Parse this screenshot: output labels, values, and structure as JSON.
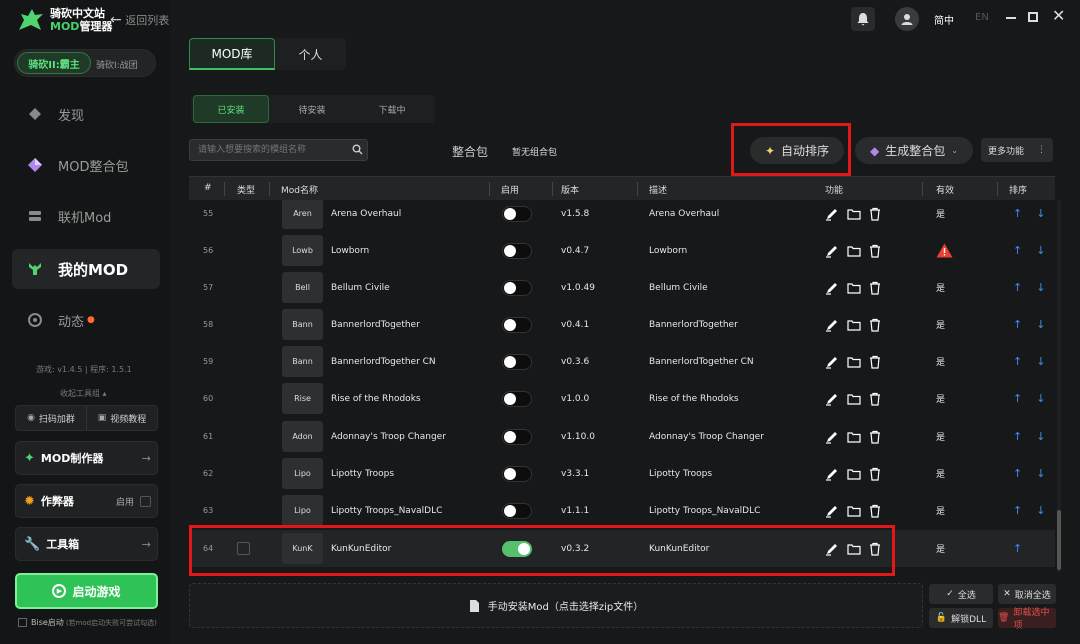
{
  "app": {
    "name_line1": "骑砍中文站",
    "name_line2_prefix": "MOD",
    "name_line2_suffix": "管理器",
    "back_label": "返回列表"
  },
  "game_switch": {
    "active": "骑砍II:霸主",
    "other": "骑砍I:战团"
  },
  "nav": [
    {
      "label": "发现",
      "icon": "discover-icon"
    },
    {
      "label": "MOD整合包",
      "icon": "diamond-icon"
    },
    {
      "label": "联机Mod",
      "icon": "network-icon"
    },
    {
      "label": "我的MOD",
      "icon": "my-mod-icon"
    },
    {
      "label": "动态",
      "icon": "chat-icon"
    }
  ],
  "version_info": {
    "game": "游戏: v1.4.5",
    "program": "程序: 1.5.1"
  },
  "collapse_tools": "收起工具组",
  "tools": {
    "scan": "扫码加群",
    "video": "视频教程"
  },
  "side_cards": {
    "mod_maker": "MOD制作器",
    "cheat": "作弊器",
    "cheat_toggle": "启用",
    "toolbox": "工具箱"
  },
  "launch_label": "启动游戏",
  "bise": {
    "label": "Bise启动",
    "hint": "(若mod启动失败可尝试勾选)"
  },
  "topbar": {
    "lang_cn": "简中",
    "lang_en": "EN"
  },
  "tabs": {
    "mod_lib": "MOD库",
    "personal": "个人"
  },
  "subtabs": [
    "已安装",
    "待安装",
    "下载中"
  ],
  "search": {
    "placeholder": "请输入想要搜索的模组名称"
  },
  "pack": {
    "label": "整合包",
    "value": "暂无组合包"
  },
  "actions": {
    "auto_sort": "自动排序",
    "gen_pack": "生成整合包",
    "more": "更多功能"
  },
  "table": {
    "headers": {
      "num": "#",
      "type": "类型",
      "name": "Mod名称",
      "enable": "启用",
      "version": "版本",
      "desc": "描述",
      "func": "功能",
      "valid": "有效",
      "sort": "排序"
    },
    "rows": [
      {
        "num": "55",
        "thumb": "Aren",
        "name": "Arena Overhaul",
        "enabled": false,
        "version": "v1.5.8",
        "desc": "Arena Overhaul",
        "valid": "是"
      },
      {
        "num": "56",
        "thumb": "Lowb",
        "name": "Lowborn",
        "enabled": false,
        "version": "v0.4.7",
        "desc": "Lowborn",
        "valid": "warning"
      },
      {
        "num": "57",
        "thumb": "Bell",
        "name": "Bellum Civile",
        "enabled": false,
        "version": "v1.0.49",
        "desc": "Bellum Civile",
        "valid": "是"
      },
      {
        "num": "58",
        "thumb": "Bann",
        "name": "BannerlordTogether",
        "enabled": false,
        "version": "v0.4.1",
        "desc": "BannerlordTogether",
        "valid": "是"
      },
      {
        "num": "59",
        "thumb": "Bann",
        "name": "BannerlordTogether CN",
        "enabled": false,
        "version": "v0.3.6",
        "desc": "BannerlordTogether CN",
        "valid": "是"
      },
      {
        "num": "60",
        "thumb": "Rise",
        "name": "Rise of the Rhodoks",
        "enabled": false,
        "version": "v1.0.0",
        "desc": "Rise of the Rhodoks",
        "valid": "是"
      },
      {
        "num": "61",
        "thumb": "Adon",
        "name": "Adonnay's Troop Changer",
        "enabled": false,
        "version": "v1.10.0",
        "desc": "Adonnay's Troop Changer",
        "valid": "是"
      },
      {
        "num": "62",
        "thumb": "Lipo",
        "name": "Lipotty Troops",
        "enabled": false,
        "version": "v3.3.1",
        "desc": "Lipotty Troops",
        "valid": "是"
      },
      {
        "num": "63",
        "thumb": "Lipo",
        "name": "Lipotty Troops_NavalDLC",
        "enabled": false,
        "version": "v1.1.1",
        "desc": "Lipotty Troops_NavalDLC",
        "valid": "是"
      },
      {
        "num": "64",
        "thumb": "KunK",
        "name": "KunKunEditor",
        "enabled": true,
        "version": "v0.3.2",
        "desc": "KunKunEditor",
        "valid": "是"
      }
    ]
  },
  "install_label": "手动安装Mod（点击选择zip文件）",
  "bottom_buttons": {
    "select_all": "全选",
    "deselect_all": "取消全选",
    "unlock_dll": "解锁DLL",
    "uninstall": "卸载选中项"
  }
}
